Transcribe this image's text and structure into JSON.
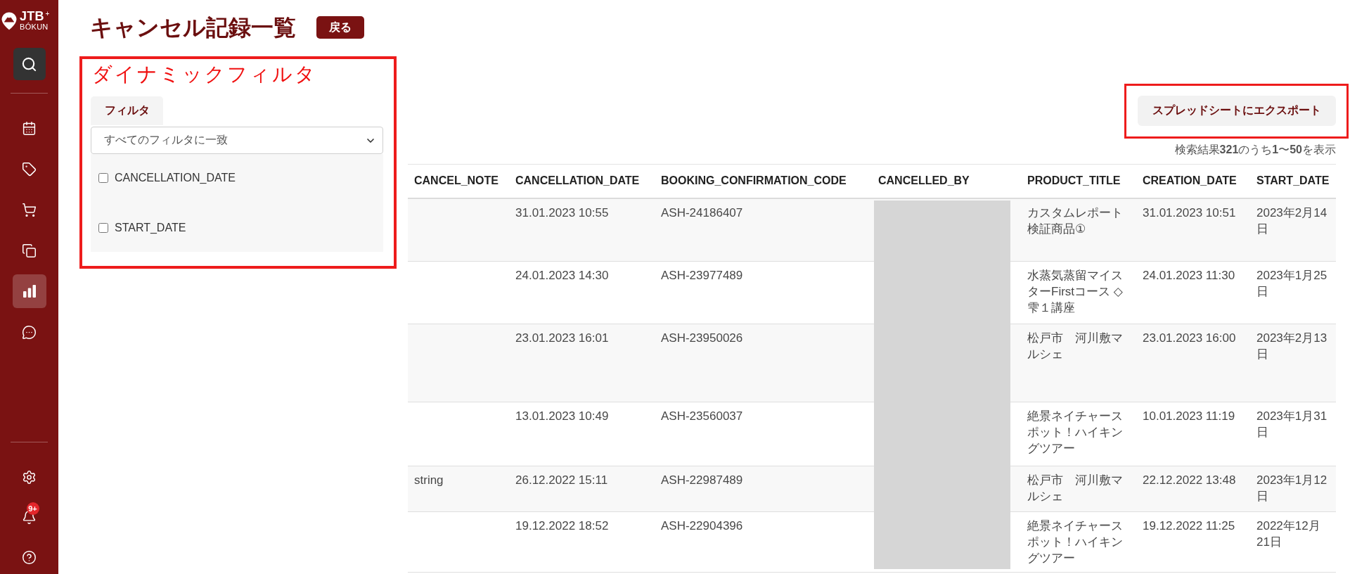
{
  "sidebar": {
    "logo": "JTB$^{+}$",
    "logo_subtitle": "BÓKUN",
    "nav_items": [
      {
        "selected": false
      },
      {
        "selected": false
      },
      {
        "selected": false
      },
      {
        "selected": false
      },
      {
        "selected": true
      },
      {
        "selected": false
      }
    ],
    "notification_badge": "9+"
  },
  "page": {
    "title": "キャンセル記録一覧",
    "back_button": "戻る"
  },
  "filter_panel": {
    "annotation": "ダイナミックフィルタ",
    "tab": "フィルタ",
    "match_select": {
      "value": "すべてのフィルタに一致"
    },
    "fields": [
      {
        "label": "CANCELLATION_DATE",
        "checked": false
      },
      {
        "label": "START_DATE",
        "checked": false
      }
    ]
  },
  "export_button": "スプレッドシートにエクスポート",
  "results_summary": "検索結果**321**のうち**1**〜**50**を表示",
  "table": {
    "columns": [
      {
        "label": "CANCEL_NOTE",
        "redacted": false
      },
      {
        "label": "CANCELLATION_DATE",
        "redacted": false
      },
      {
        "label": "BOOKING_CONFIRMATION_CODE",
        "redacted": false
      },
      {
        "label": "CANCELLED_BY",
        "redacted": true
      },
      {
        "label": "PRODUCT_TITLE",
        "redacted": false
      },
      {
        "label": "CREATION_DATE",
        "redacted": false
      },
      {
        "label": "START_DATE",
        "redacted": false
      }
    ],
    "rows": [
      {
        "cancellation_date": "31.01.2023 10:55",
        "booking_confirmation_code": "ASH-24186407",
        "product_title": "カスタムレポート検証商品①",
        "creation_date": "31.01.2023 10:51",
        "start_date": "2023年2月14日"
      },
      {
        "cancellation_date": "24.01.2023 14:30",
        "booking_confirmation_code": "ASH-23977489",
        "product_title": "水蒸気蒸留マイスターFirstコース ◇雫１講座",
        "creation_date": "24.01.2023 11:30",
        "start_date": "2023年1月25日"
      },
      {
        "cancellation_date": "23.01.2023 16:01",
        "booking_confirmation_code": "ASH-23950026",
        "product_title": "松戸市　河川敷マルシェ",
        "creation_date": "23.01.2023 16:00",
        "start_date": "2023年2月13日"
      },
      {
        "cancellation_date": "13.01.2023 10:49",
        "booking_confirmation_code": "ASH-23560037",
        "product_title": "絶景ネイチャースポット！ハイキングツアー",
        "creation_date": "10.01.2023 11:19",
        "start_date": "2023年1月31日"
      },
      {
        "cancel_note": "string",
        "cancellation_date": "26.12.2022 15:11",
        "booking_confirmation_code": "ASH-22987489",
        "product_title": "松戸市　河川敷マルシェ",
        "creation_date": "22.12.2022 13:48",
        "start_date": "2023年1月12日"
      },
      {
        "cancellation_date": "19.12.2022 18:52",
        "booking_confirmation_code": "ASH-22904396",
        "product_title": "絶景ネイチャースポット！ハイキングツアー",
        "creation_date": "19.12.2022 11:25",
        "start_date": "2022年12月21日"
      }
    ]
  }
}
